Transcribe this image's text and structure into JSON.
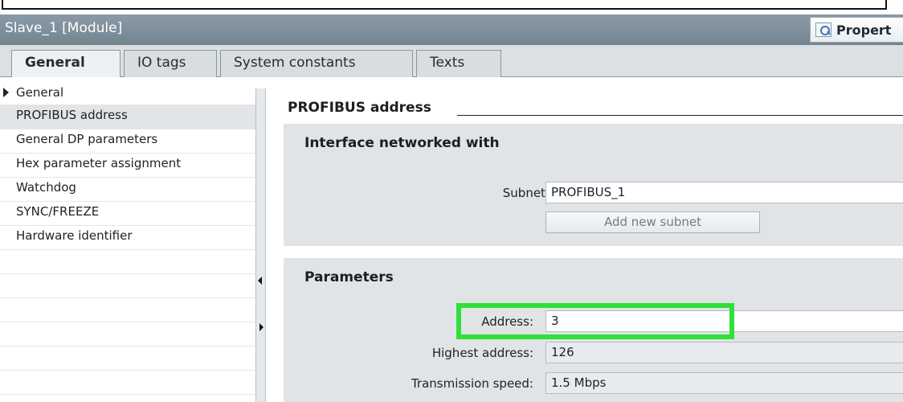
{
  "window": {
    "title": "Slave_1 [Module]",
    "properties_label": "Propert"
  },
  "tabs": [
    {
      "label": "General",
      "active": true
    },
    {
      "label": "IO tags",
      "active": false
    },
    {
      "label": "System constants",
      "active": false
    },
    {
      "label": "Texts",
      "active": false
    }
  ],
  "nav": {
    "items": [
      {
        "label": "General",
        "expandable": true
      },
      {
        "label": "PROFIBUS address",
        "selected": true
      },
      {
        "label": "General DP parameters"
      },
      {
        "label": "Hex parameter assignment"
      },
      {
        "label": "Watchdog"
      },
      {
        "label": "SYNC/FREEZE"
      },
      {
        "label": "Hardware identifier"
      }
    ]
  },
  "content": {
    "section_title": "PROFIBUS address",
    "interface_group": {
      "title": "Interface networked with",
      "subnet_label": "Subnet:",
      "subnet_value": "PROFIBUS_1",
      "add_subnet_button": "Add new subnet"
    },
    "parameters_group": {
      "title": "Parameters",
      "address_label": "Address:",
      "address_value": "3",
      "highest_address_label": "Highest address:",
      "highest_address_value": "126",
      "transmission_speed_label": "Transmission speed:",
      "transmission_speed_value": "1.5 Mbps"
    }
  },
  "colors": {
    "titlebar": "#7d8d99",
    "highlight": "#2fe038",
    "group_background": "#e0e4e7"
  },
  "icons": {
    "properties": "magnifier-icon",
    "nav_expand": "triangle-right-icon",
    "collapse_left": "arrow-left-icon",
    "expand_right": "arrow-right-icon"
  }
}
